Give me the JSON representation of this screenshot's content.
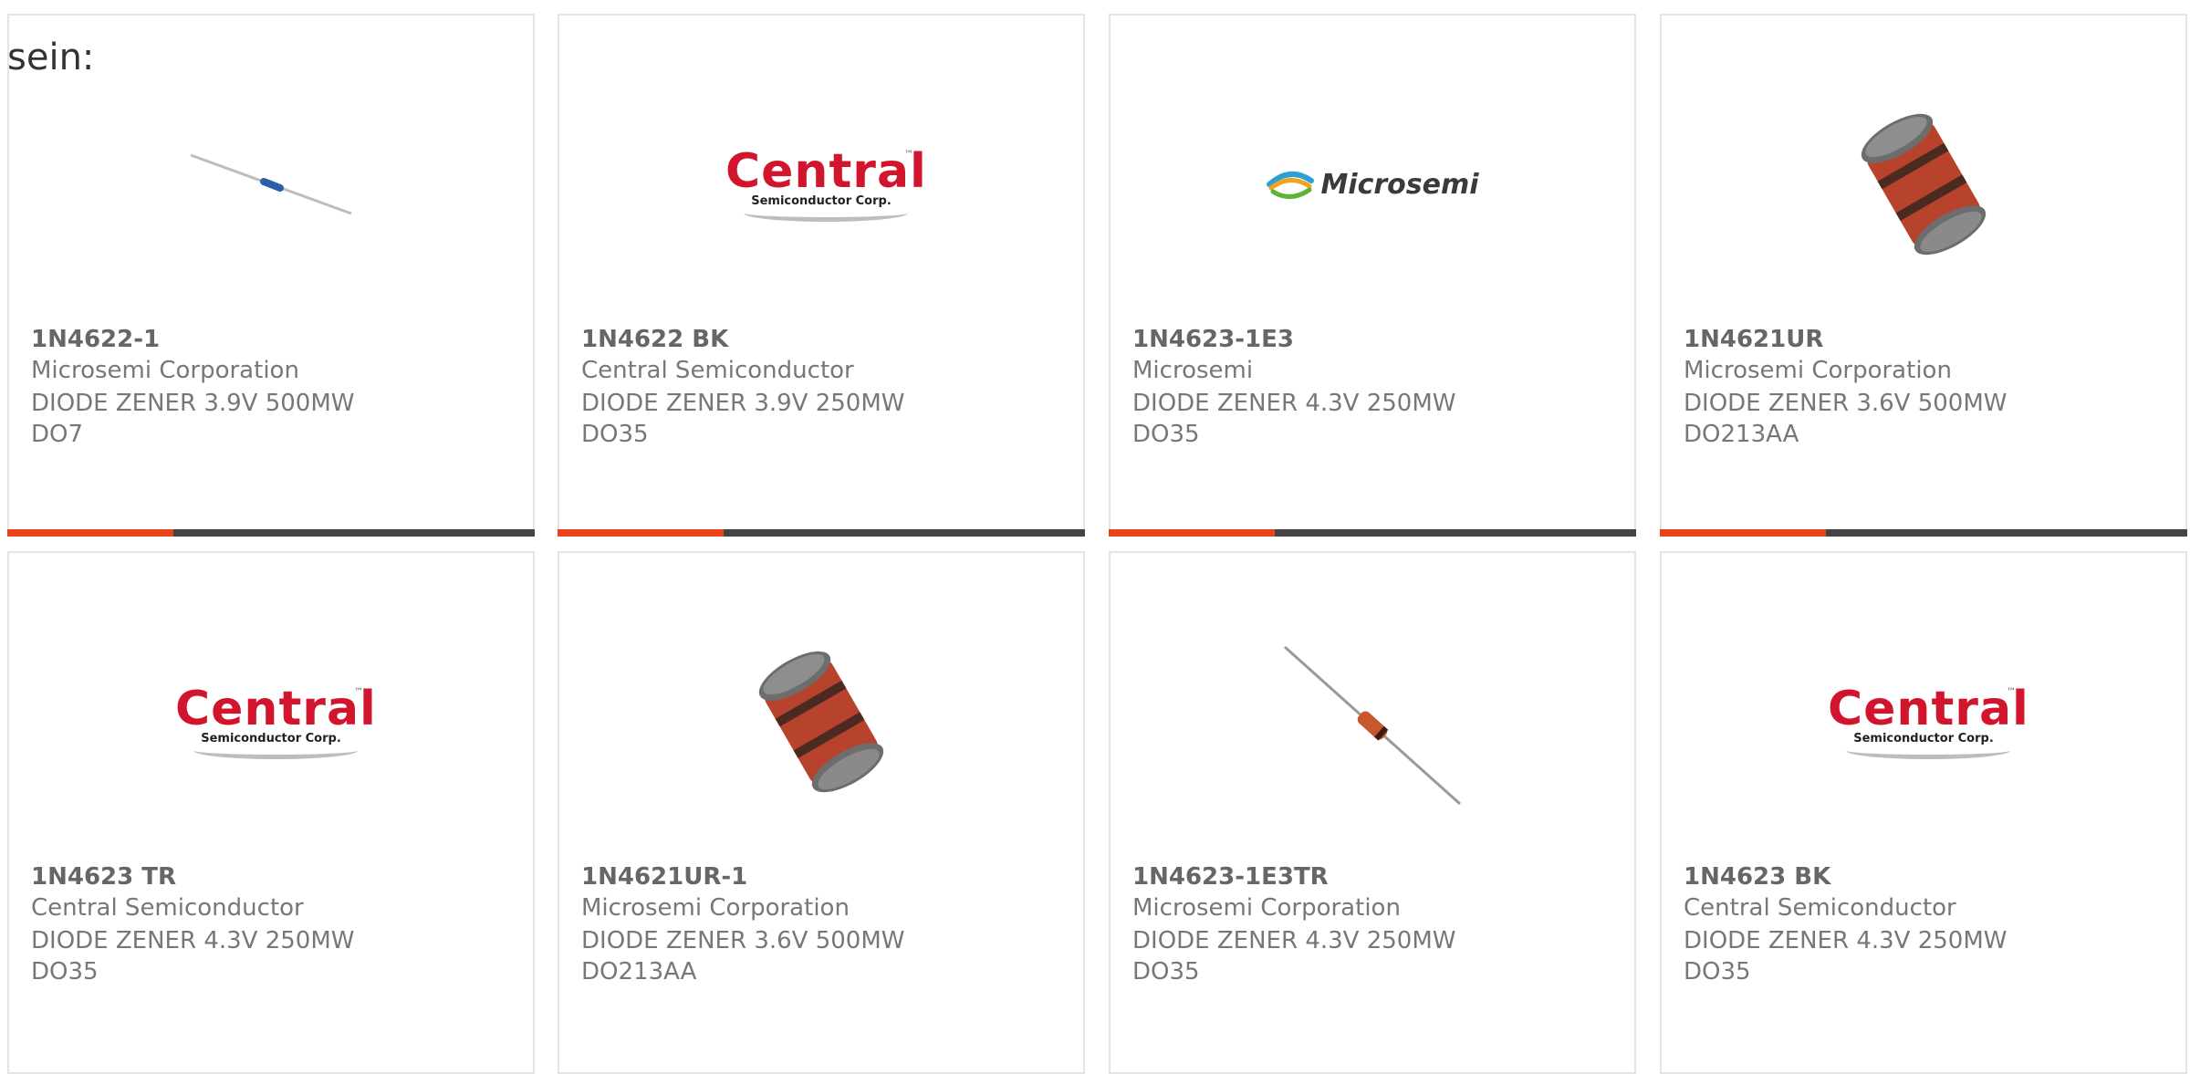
{
  "intro_text": "sein:",
  "colors": {
    "accent": "#e8431b",
    "bar_dark": "#444444",
    "logo_red": "#d0152d"
  },
  "logos": {
    "central": {
      "word": "Central",
      "sub": "Semiconductor Corp.",
      "tm": "™"
    },
    "microsemi": {
      "word": "Microsemi"
    }
  },
  "products": [
    {
      "part": "1N4622-1",
      "maker": "Microsemi Corporation",
      "desc": "DIODE ZENER 3.9V 500MW DO7",
      "image": "axial-diode-thin-icon"
    },
    {
      "part": "1N4622 BK",
      "maker": "Central Semiconductor",
      "desc": "DIODE ZENER 3.9V 250MW DO35",
      "image": "central-logo"
    },
    {
      "part": "1N4623-1E3",
      "maker": "Microsemi",
      "desc": "DIODE ZENER 4.3V 250MW DO35",
      "image": "microsemi-logo"
    },
    {
      "part": "1N4621UR",
      "maker": "Microsemi Corporation",
      "desc": "DIODE ZENER 3.6V 500MW DO213AA",
      "image": "melf-diode-icon"
    },
    {
      "part": "1N4623 TR",
      "maker": "Central Semiconductor",
      "desc": "DIODE ZENER 4.3V 250MW DO35",
      "image": "central-logo"
    },
    {
      "part": "1N4621UR-1",
      "maker": "Microsemi Corporation",
      "desc": "DIODE ZENER 3.6V 500MW DO213AA",
      "image": "melf-diode-icon"
    },
    {
      "part": "1N4623-1E3TR",
      "maker": "Microsemi Corporation",
      "desc": "DIODE ZENER 4.3V 250MW DO35",
      "image": "axial-diode-icon"
    },
    {
      "part": "1N4623 BK",
      "maker": "Central Semiconductor",
      "desc": "DIODE ZENER 4.3V 250MW DO35",
      "image": "central-logo"
    }
  ]
}
